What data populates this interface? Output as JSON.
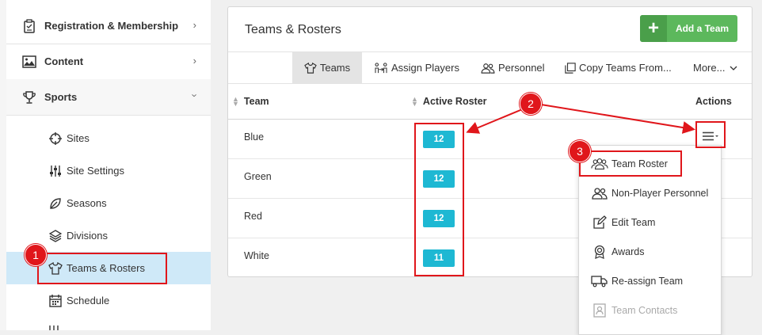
{
  "sidebar": {
    "items": [
      {
        "label": "Registration & Membership",
        "icon": "clipboard-icon"
      },
      {
        "label": "Content",
        "icon": "image-icon"
      },
      {
        "label": "Sports",
        "icon": "trophy-icon"
      }
    ],
    "sub_items": [
      {
        "label": "Sites",
        "icon": "crosshair-icon"
      },
      {
        "label": "Site Settings",
        "icon": "sliders-icon"
      },
      {
        "label": "Seasons",
        "icon": "leaf-icon"
      },
      {
        "label": "Divisions",
        "icon": "layers-icon"
      },
      {
        "label": "Teams & Rosters",
        "icon": "shirt-icon",
        "active": true
      },
      {
        "label": "Schedule",
        "icon": "calendar-icon"
      }
    ]
  },
  "panel": {
    "title": "Teams & Rosters",
    "add_button": "Add a Team",
    "tabs": [
      {
        "label": "Teams",
        "icon": "shirt-icon",
        "active": true
      },
      {
        "label": "Assign Players",
        "icon": "assign-players-icon"
      },
      {
        "label": "Personnel",
        "icon": "users-icon"
      },
      {
        "label": "Copy Teams From...",
        "icon": "copy-icon"
      },
      {
        "label": "More...",
        "icon": "chevron-down-icon"
      }
    ],
    "columns": {
      "team": "Team",
      "active_roster": "Active Roster",
      "actions": "Actions"
    },
    "rows": [
      {
        "team": "Blue",
        "roster": "12"
      },
      {
        "team": "Green",
        "roster": "12"
      },
      {
        "team": "Red",
        "roster": "12"
      },
      {
        "team": "White",
        "roster": "11"
      }
    ]
  },
  "actions_menu": [
    {
      "label": "Team Roster",
      "icon": "team-roster-icon"
    },
    {
      "label": "Non-Player Personnel",
      "icon": "users-icon"
    },
    {
      "label": "Edit Team",
      "icon": "edit-icon"
    },
    {
      "label": "Awards",
      "icon": "award-icon"
    },
    {
      "label": "Re-assign Team",
      "icon": "truck-icon"
    },
    {
      "label": "Team Contacts",
      "icon": "contact-card-icon",
      "disabled": true
    }
  ],
  "callouts": [
    "1",
    "2",
    "3"
  ],
  "colors": {
    "accent_red": "#e0161b",
    "badge_blue": "#1eb8d3",
    "add_green": "#5cb85c",
    "active_blue": "#cfe9f8"
  }
}
